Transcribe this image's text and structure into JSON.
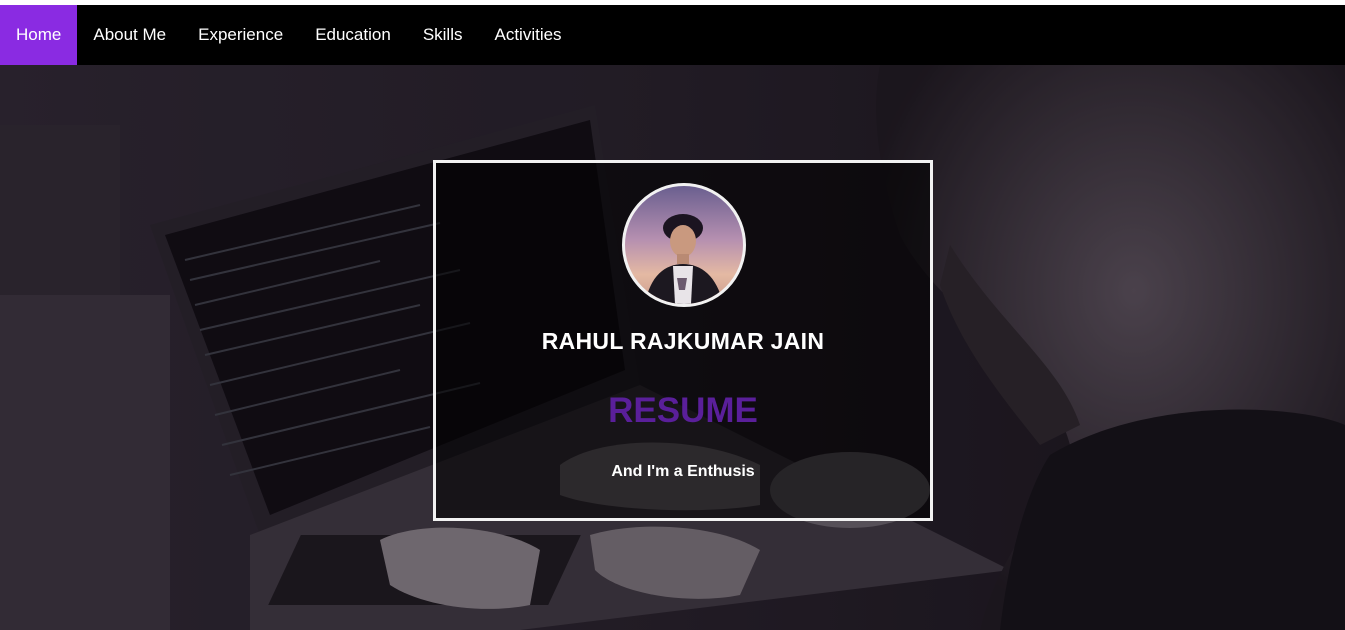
{
  "nav": {
    "items": [
      {
        "label": "Home",
        "active": true
      },
      {
        "label": "About Me",
        "active": false
      },
      {
        "label": "Experience",
        "active": false
      },
      {
        "label": "Education",
        "active": false
      },
      {
        "label": "Skills",
        "active": false
      },
      {
        "label": "Activities",
        "active": false
      }
    ],
    "active_color": "#8a2be2"
  },
  "hero": {
    "background_image": "person-typing-on-laptop-photo",
    "name": "RAHUL RAJKUMAR JAIN",
    "title": "RESUME",
    "tagline": "And I'm a Enthusis",
    "title_color": "#5a1f9a",
    "avatar": "profile-photo"
  }
}
